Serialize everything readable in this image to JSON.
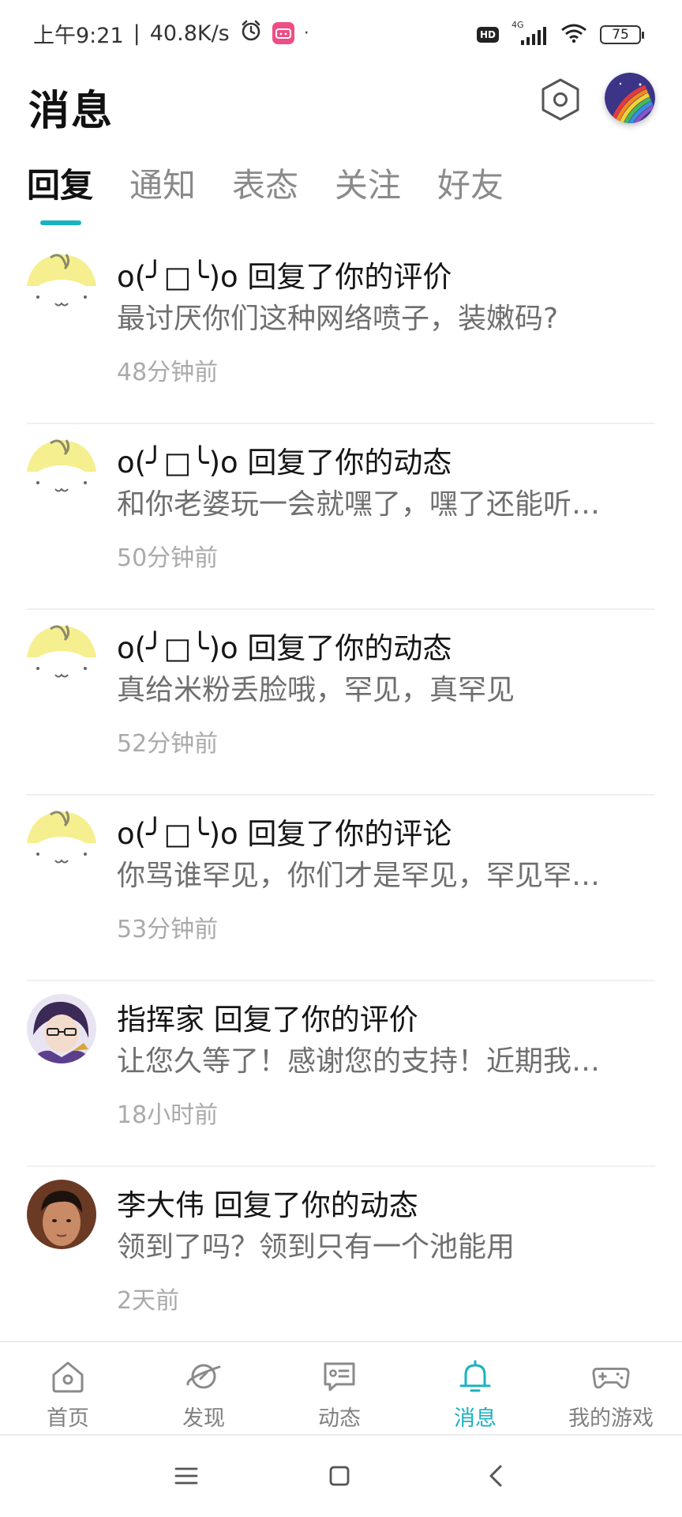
{
  "status_bar": {
    "time": "上午9:21",
    "separator": "|",
    "speed": "40.8K/s",
    "dot": "·",
    "network": "4G",
    "hd_badge": "HD",
    "battery": "75",
    "icons": [
      "alarm-icon",
      "bilibili-badge-icon",
      "signal-icon",
      "wifi-icon",
      "battery-icon"
    ]
  },
  "header": {
    "title": "消息",
    "settings_icon": "hexagon-settings-icon",
    "avatar_icon": "rainbow-avatar-icon"
  },
  "tabs": [
    {
      "label": "回复",
      "active": true
    },
    {
      "label": "通知",
      "active": false
    },
    {
      "label": "表态",
      "active": false
    },
    {
      "label": "关注",
      "active": false
    },
    {
      "label": "好友",
      "active": false
    }
  ],
  "messages": [
    {
      "title": "o(╯□╰)o 回复了你的评价",
      "content": "最讨厌你们这种网络喷子，装嫩码?",
      "time": "48分钟前",
      "avatar": "default-cartoon-avatar"
    },
    {
      "title": "o(╯□╰)o 回复了你的动态",
      "content": "和你老婆玩一会就嘿了，嘿了还能听…",
      "time": "50分钟前",
      "avatar": "default-cartoon-avatar"
    },
    {
      "title": "o(╯□╰)o 回复了你的动态",
      "content": "真给米粉丢脸哦，罕见，真罕见",
      "time": "52分钟前",
      "avatar": "default-cartoon-avatar"
    },
    {
      "title": "o(╯□╰)o 回复了你的评论",
      "content": "你骂谁罕见，你们才是罕见，罕见罕…",
      "time": "53分钟前",
      "avatar": "default-cartoon-avatar"
    },
    {
      "title": "指挥家 回复了你的评价",
      "content": "让您久等了！感谢您的支持！近期我…",
      "time": "18小时前",
      "avatar": "anime-character-avatar"
    },
    {
      "title": "李大伟 回复了你的动态",
      "content": "领到了吗？领到只有一个池能用",
      "time": "2天前",
      "avatar": "photo-avatar"
    }
  ],
  "bottom_nav": [
    {
      "label": "首页",
      "icon": "home-icon",
      "active": false
    },
    {
      "label": "发现",
      "icon": "planet-icon",
      "active": false
    },
    {
      "label": "动态",
      "icon": "message-card-icon",
      "active": false
    },
    {
      "label": "消息",
      "icon": "bell-icon",
      "active": true
    },
    {
      "label": "我的游戏",
      "icon": "gamepad-icon",
      "active": false
    }
  ],
  "colors": {
    "accent": "#1ab2c1",
    "inactive": "#808080",
    "time_text": "#aaaaaa"
  }
}
